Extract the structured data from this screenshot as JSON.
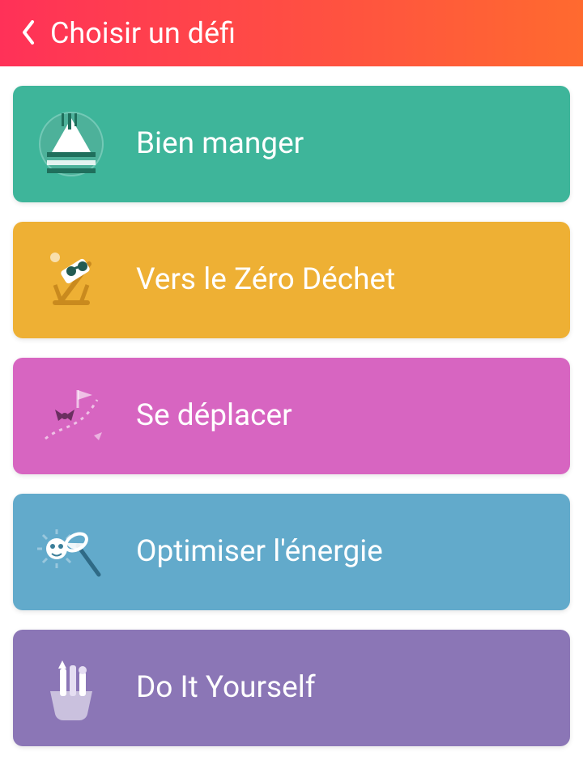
{
  "header": {
    "title": "Choisir un défi"
  },
  "categories": [
    {
      "label": "Bien manger",
      "icon": "food-plate-icon",
      "color": "#3eb59a"
    },
    {
      "label": "Vers le Zéro Déchet",
      "icon": "beach-chair-icon",
      "color": "#eeb034"
    },
    {
      "label": "Se déplacer",
      "icon": "route-flags-icon",
      "color": "#d765c1"
    },
    {
      "label": "Optimiser l'énergie",
      "icon": "net-sun-icon",
      "color": "#62aacb"
    },
    {
      "label": "Do It Yourself",
      "icon": "tool-basket-icon",
      "color": "#8b76b6"
    }
  ]
}
